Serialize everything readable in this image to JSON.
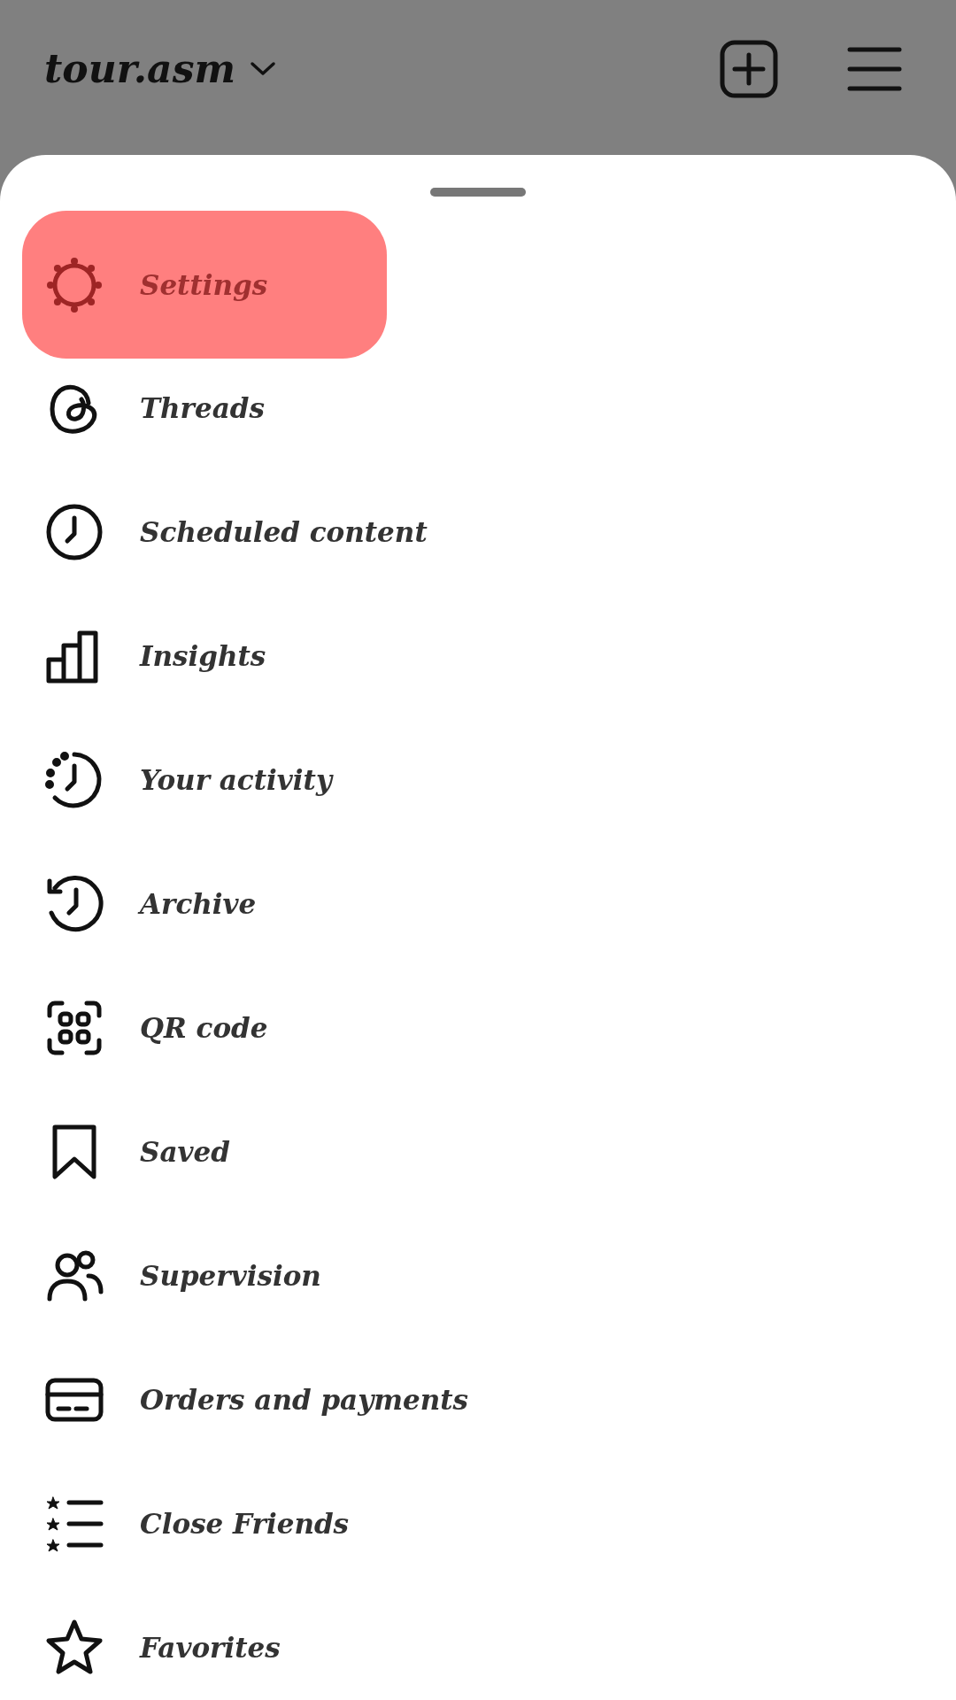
{
  "header": {
    "username": "tour.asm"
  },
  "menu": [
    {
      "label": "Settings",
      "selected": true
    },
    {
      "label": "Threads",
      "selected": false
    },
    {
      "label": "Scheduled content",
      "selected": false
    },
    {
      "label": "Insights",
      "selected": false
    },
    {
      "label": "Your activity",
      "selected": false
    },
    {
      "label": "Archive",
      "selected": false
    },
    {
      "label": "QR code",
      "selected": false
    },
    {
      "label": "Saved",
      "selected": false
    },
    {
      "label": "Supervision",
      "selected": false
    },
    {
      "label": "Orders and payments",
      "selected": false
    },
    {
      "label": "Close Friends",
      "selected": false
    },
    {
      "label": "Favorites",
      "selected": false
    }
  ]
}
